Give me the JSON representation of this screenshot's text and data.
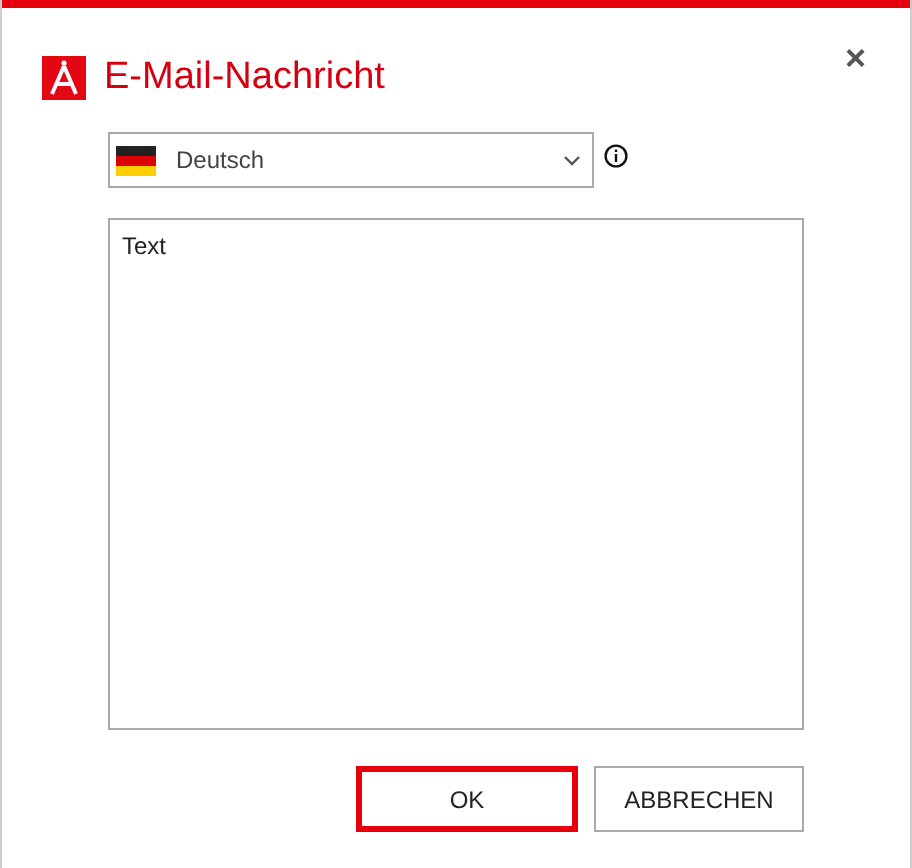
{
  "window": {
    "title": "E-Mail-Nachricht",
    "close": "×"
  },
  "language": {
    "value": "Deutsch"
  },
  "message": {
    "value": "Text"
  },
  "buttons": [
    {
      "label": "OK",
      "focused": true
    },
    {
      "label": "ABBRECHEN",
      "focused": false
    }
  ]
}
